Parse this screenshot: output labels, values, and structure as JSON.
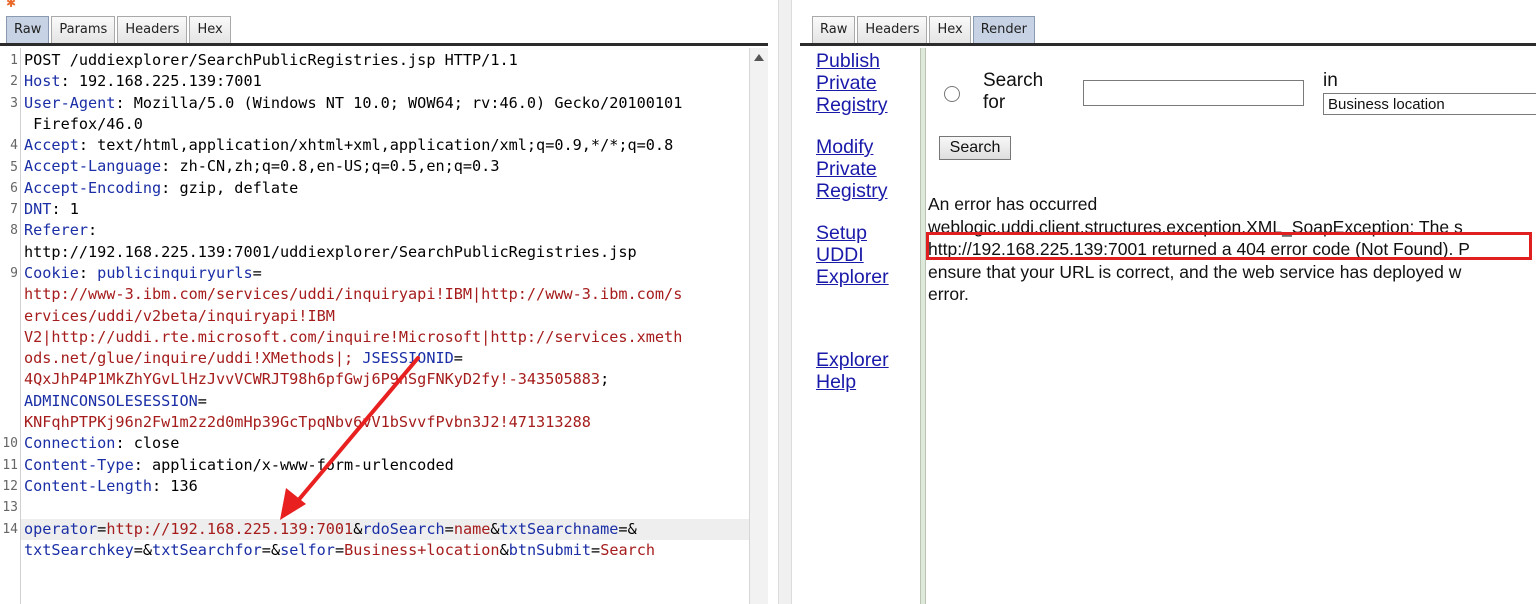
{
  "request_panel": {
    "tabs": [
      {
        "label": "Raw",
        "active": true
      },
      {
        "label": "Params",
        "active": false
      },
      {
        "label": "Headers",
        "active": false
      },
      {
        "label": "Hex",
        "active": false
      }
    ],
    "line_numbers": [
      "1",
      "2",
      "3",
      "4",
      "5",
      "6",
      "7",
      "8",
      "9",
      "10",
      "11",
      "12",
      "13",
      "14"
    ],
    "lines": {
      "l1": "POST /uddiexplorer/SearchPublicRegistries.jsp HTTP/1.1",
      "l2k": "Host",
      "l2v": ": 192.168.225.139:7001",
      "l3k": "User-Agent",
      "l3v": ": Mozilla/5.0 (Windows NT 10.0; WOW64; rv:46.0) Gecko/20100101",
      "l3c": " Firefox/46.0",
      "l4k": "Accept",
      "l4v": ": text/html,application/xhtml+xml,application/xml;q=0.9,*/*;q=0.8",
      "l5k": "Accept-Language",
      "l5v": ": zh-CN,zh;q=0.8,en-US;q=0.5,en;q=0.3",
      "l6k": "Accept-Encoding",
      "l6v": ": gzip, deflate",
      "l7k": "DNT",
      "l7v": ": 1",
      "l8k": "Referer",
      "l8v": ":",
      "l8c": "http://192.168.225.139:7001/uddiexplorer/SearchPublicRegistries.jsp",
      "l9k": "Cookie",
      "l9s": ": ",
      "l9n": "publicinquiryurls",
      "l9e": "=",
      "l9a": "http://www-3.ibm.com/services/uddi/inquiryapi!IBM|http://www-3.ibm.com/s",
      "l9b": "ervices/uddi/v2beta/inquiryapi!IBM",
      "l9c": "V2|http://uddi.rte.microsoft.com/inquire!Microsoft|http://services.xmeth",
      "l9d": "ods.net/glue/inquire/uddi!XMethods|;",
      "l9j": " JSESSIONID",
      "l9je": "=",
      "l9f": "4QxJhP4P1MkZhYGvLlHzJvvVCWRJT98h6pfGwj6P9nSgFNKyD2fy!-343505883",
      "l9g": ";",
      "l9h": "ADMINCONSOLESESSION",
      "l9he": "=",
      "l9i": "KNFqhPTPKj96n2Fw1m2z2d0mHp39GcTpqNbv6vV1bSvvfPvbn3J2!471313288",
      "l10k": "Connection",
      "l10v": ": close",
      "l11k": "Content-Type",
      "l11v": ": application/x-www-form-urlencoded",
      "l12k": "Content-Length",
      "l12v": ": 136",
      "p1k": "operator",
      "p1v": "http://192.168.225.139:7001",
      "p2k": "rdoSearch",
      "p2v": "name",
      "p3k": "txtSearchname",
      "p3v": "",
      "p4k": "txtSearchkey",
      "p4v": "",
      "p5k": "txtSearchfor",
      "p5v": "",
      "p6k": "selfor",
      "p6v": "Business+location",
      "p7k": "btnSubmit",
      "p7v": "Search",
      "eq": "=",
      "amp": "&"
    }
  },
  "response_panel": {
    "tabs": [
      {
        "label": "Raw",
        "active": false
      },
      {
        "label": "Headers",
        "active": false
      },
      {
        "label": "Hex",
        "active": false
      },
      {
        "label": "Render",
        "active": true
      }
    ],
    "nav_links": [
      "Publish",
      "Private",
      "Registry",
      "Modify",
      "Private",
      "Registry",
      "Setup",
      "UDDI",
      "Explorer",
      "Explorer",
      "Help"
    ],
    "search_label_1": "Search",
    "search_label_2": "for",
    "in_label": "in",
    "select_value": "Business location",
    "search_button": "Search",
    "error_lines": [
      "An error has occurred",
      "weblogic.uddi.client.structures.exception.XML_SoapException: The s",
      "http://192.168.225.139:7001 returned a 404 error code (Not Found). P",
      "ensure that your URL is correct, and the web service has deployed w",
      "error."
    ]
  },
  "colors": {
    "accent_tab": "#c7d3e4",
    "link": "#1a1aaa",
    "header_key": "#1a2ea6",
    "value_red": "#a61c1c",
    "highlight_box": "#e02020"
  },
  "icons": [
    "burp-logo-icon",
    "scroll-up-arrow-icon",
    "radio-button-icon",
    "annotation-arrow-icon"
  ]
}
